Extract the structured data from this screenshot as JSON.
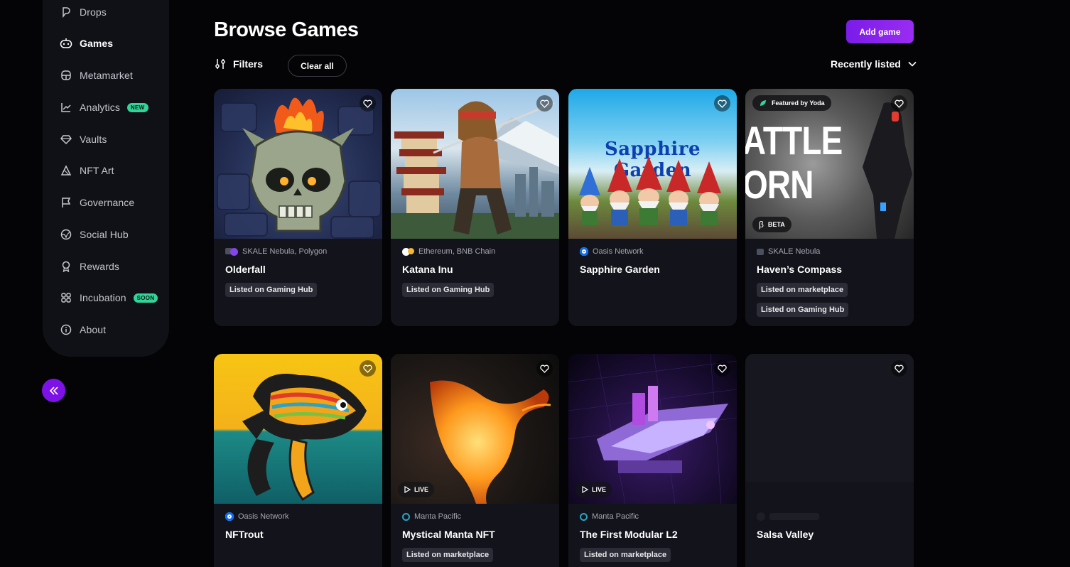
{
  "sidebar": {
    "items": [
      {
        "label": "Drops",
        "icon": "drop-icon"
      },
      {
        "label": "Games",
        "icon": "gamepad-icon"
      },
      {
        "label": "Metamarket",
        "icon": "store-icon"
      },
      {
        "label": "Analytics",
        "icon": "chart-icon",
        "pill": "NEW"
      },
      {
        "label": "Vaults",
        "icon": "diamond-icon"
      },
      {
        "label": "NFT Art",
        "icon": "art-icon"
      },
      {
        "label": "Governance",
        "icon": "flag-icon"
      },
      {
        "label": "Social Hub",
        "icon": "globe-icon"
      },
      {
        "label": "Rewards",
        "icon": "award-icon"
      },
      {
        "label": "Incubation",
        "icon": "grid-icon",
        "pill": "SOON"
      },
      {
        "label": "About",
        "icon": "info-icon"
      }
    ],
    "active": "Games"
  },
  "header": {
    "title": "Browse Games",
    "add_game": "Add game",
    "filters": "Filters",
    "clear_all": "Clear all",
    "sort": "Recently listed"
  },
  "games": [
    {
      "name": "Olderfall",
      "chain": "SKALE Nebula, Polygon",
      "tags": [
        "Listed on Gaming Hub"
      ]
    },
    {
      "name": "Katana Inu",
      "chain": "Ethereum, BNB Chain",
      "tags": [
        "Listed on Gaming Hub"
      ]
    },
    {
      "name": "Sapphire Garden",
      "chain": "Oasis Network",
      "tags": [],
      "art_text": "Sapphire Garden"
    },
    {
      "name": "Haven’s Compass",
      "chain": "SKALE Nebula",
      "tags": [
        "Listed on marketplace",
        "Listed on Gaming Hub"
      ],
      "featured": "Featured by Yoda",
      "beta": "BETA",
      "art_text_1": "ATTLE",
      "art_text_2": "ORN"
    },
    {
      "name": "NFTrout",
      "chain": "Oasis Network",
      "tags": []
    },
    {
      "name": "Mystical Manta NFT",
      "chain": "Manta Pacific",
      "tags": [
        "Listed on marketplace"
      ],
      "live": "LIVE"
    },
    {
      "name": "The First Modular L2",
      "chain": "Manta Pacific",
      "tags": [
        "Listed on marketplace"
      ],
      "live": "LIVE"
    },
    {
      "name": "Salsa Valley",
      "chain": "",
      "tags": []
    }
  ],
  "colors": {
    "accent": "#7c12e6",
    "pill_green": "#34d399",
    "card_bg": "#13141b",
    "page_bg": "#040406"
  }
}
